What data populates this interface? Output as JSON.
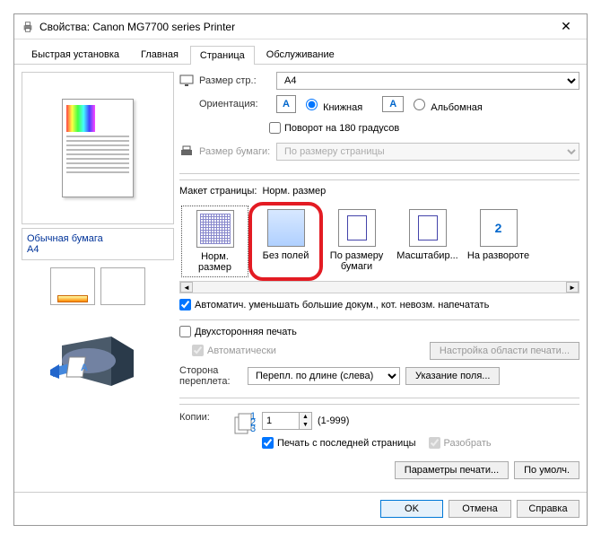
{
  "window": {
    "title": "Свойства: Canon MG7700 series Printer"
  },
  "tabs": [
    "Быстрая установка",
    "Главная",
    "Страница",
    "Обслуживание"
  ],
  "active_tab": 2,
  "page_size": {
    "label": "Размер стр.:",
    "value": "A4"
  },
  "orientation": {
    "label": "Ориентация:",
    "portrait": "Книжная",
    "landscape": "Альбомная",
    "rotate": "Поворот на 180 градусов"
  },
  "paper_size": {
    "label": "Размер бумаги:",
    "value": "По размеру страницы"
  },
  "layout": {
    "label": "Макет страницы:",
    "current": "Норм. размер",
    "items": [
      {
        "name": "Норм. размер",
        "kind": "normal"
      },
      {
        "name": "Без полей",
        "kind": "borderless"
      },
      {
        "name": "По размеру бумаги",
        "kind": "fit"
      },
      {
        "name": "Масштабир...",
        "kind": "scale"
      },
      {
        "name": "На развороте",
        "kind": "spread"
      }
    ],
    "auto_shrink": "Автоматич. уменьшать большие докум., кот. невозм. напечатать"
  },
  "duplex": {
    "label": "Двухсторонняя печать",
    "auto": "Автоматически",
    "area_btn": "Настройка области печати..."
  },
  "binding": {
    "label": "Сторона переплета:",
    "value": "Перепл. по длине (слева)",
    "margin_btn": "Указание поля..."
  },
  "copies": {
    "label": "Копии:",
    "value": "1",
    "range": "(1-999)",
    "reverse": "Печать с последней страницы",
    "collate": "Разобрать"
  },
  "buttons": {
    "print_params": "Параметры печати...",
    "defaults": "По умолч.",
    "ok": "OK",
    "cancel": "Отмена",
    "help": "Справка"
  },
  "left_panel": {
    "paper_type": "Обычная бумага",
    "size": "A4"
  }
}
